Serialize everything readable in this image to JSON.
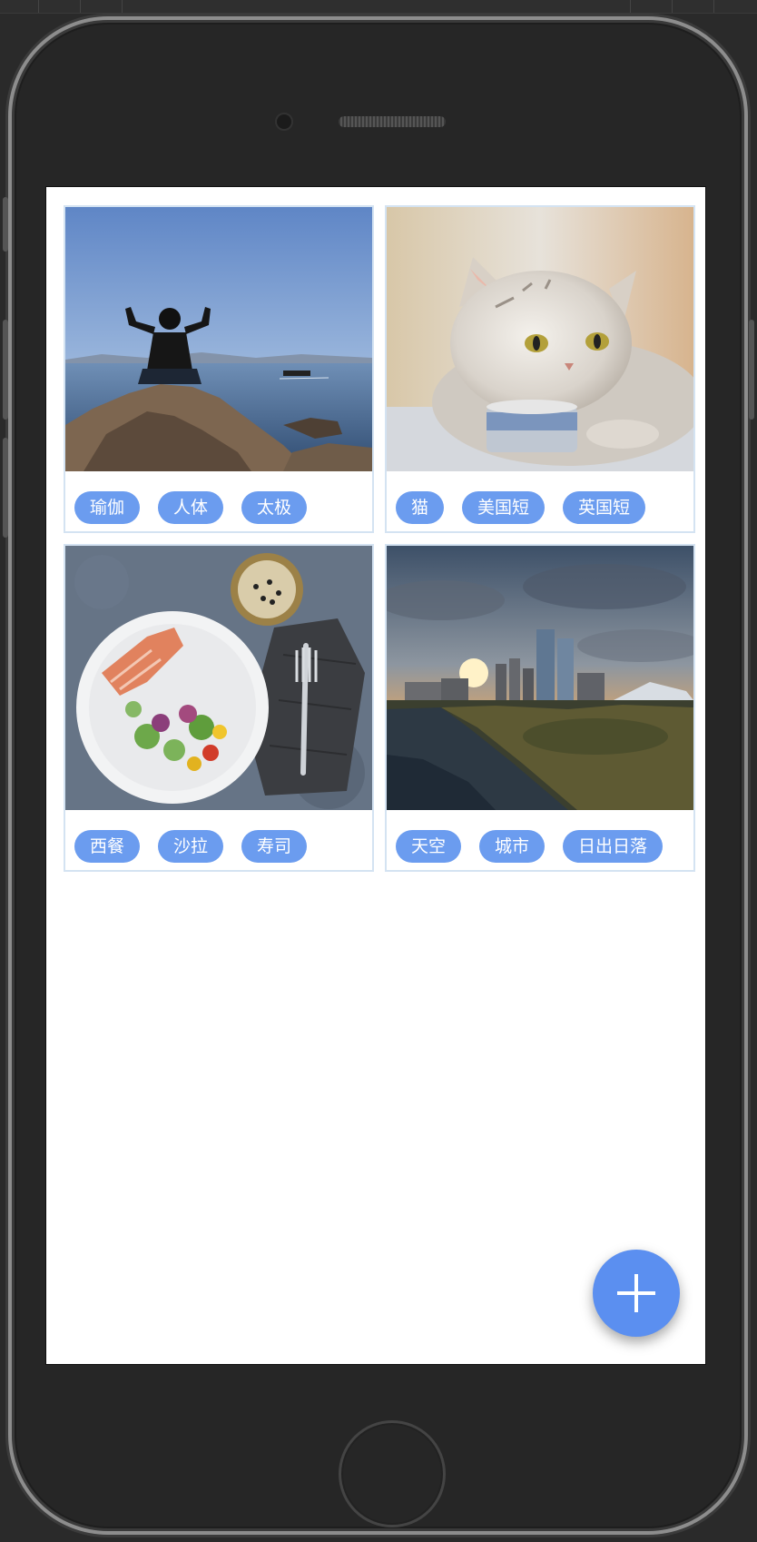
{
  "cards": [
    {
      "name": "yoga-photo",
      "tags": [
        "瑜伽",
        "人体",
        "太极"
      ]
    },
    {
      "name": "cat-photo",
      "tags": [
        "猫",
        "美国短",
        "英国短"
      ]
    },
    {
      "name": "salad-photo",
      "tags": [
        "西餐",
        "沙拉",
        "寿司"
      ]
    },
    {
      "name": "city-photo",
      "tags": [
        "天空",
        "城市",
        "日出日落"
      ]
    }
  ],
  "fab": {
    "icon": "plus-icon",
    "color": "#5b8ff0"
  },
  "colors": {
    "tag_bg": "#6b9cef",
    "card_border": "#d4e3f2",
    "screen_bg": "#ffffff",
    "device": "#262626"
  }
}
